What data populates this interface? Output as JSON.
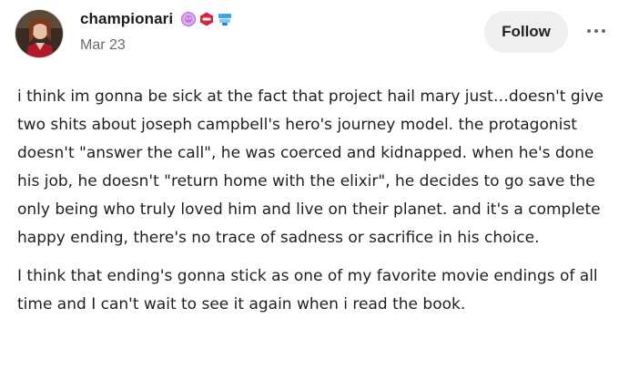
{
  "post": {
    "author": {
      "username": "championari",
      "avatar_icon": "user-avatar",
      "badges": [
        "pink-badge-icon",
        "red-badge-icon",
        "blue-badge-icon"
      ]
    },
    "date": "Mar 23",
    "follow_label": "Follow",
    "more_icon": "more-options-icon",
    "paragraphs": [
      "i think im gonna be sick at the fact that project hail mary just…doesn't give two shits about joseph campbell's hero's journey model. the protagonist doesn't \"answer the call\", he was coerced and kidnapped. when he's done his job, he doesn't \"return home with the elixir\", he decides to go save the only being who truly loved him and live on their planet. and it's a complete happy ending, there's no trace of sadness or sacrifice in his choice.",
      "I think that ending's gonna stick as one of my favorite movie endings of all time and I can't wait to see it again when i read the book."
    ]
  }
}
